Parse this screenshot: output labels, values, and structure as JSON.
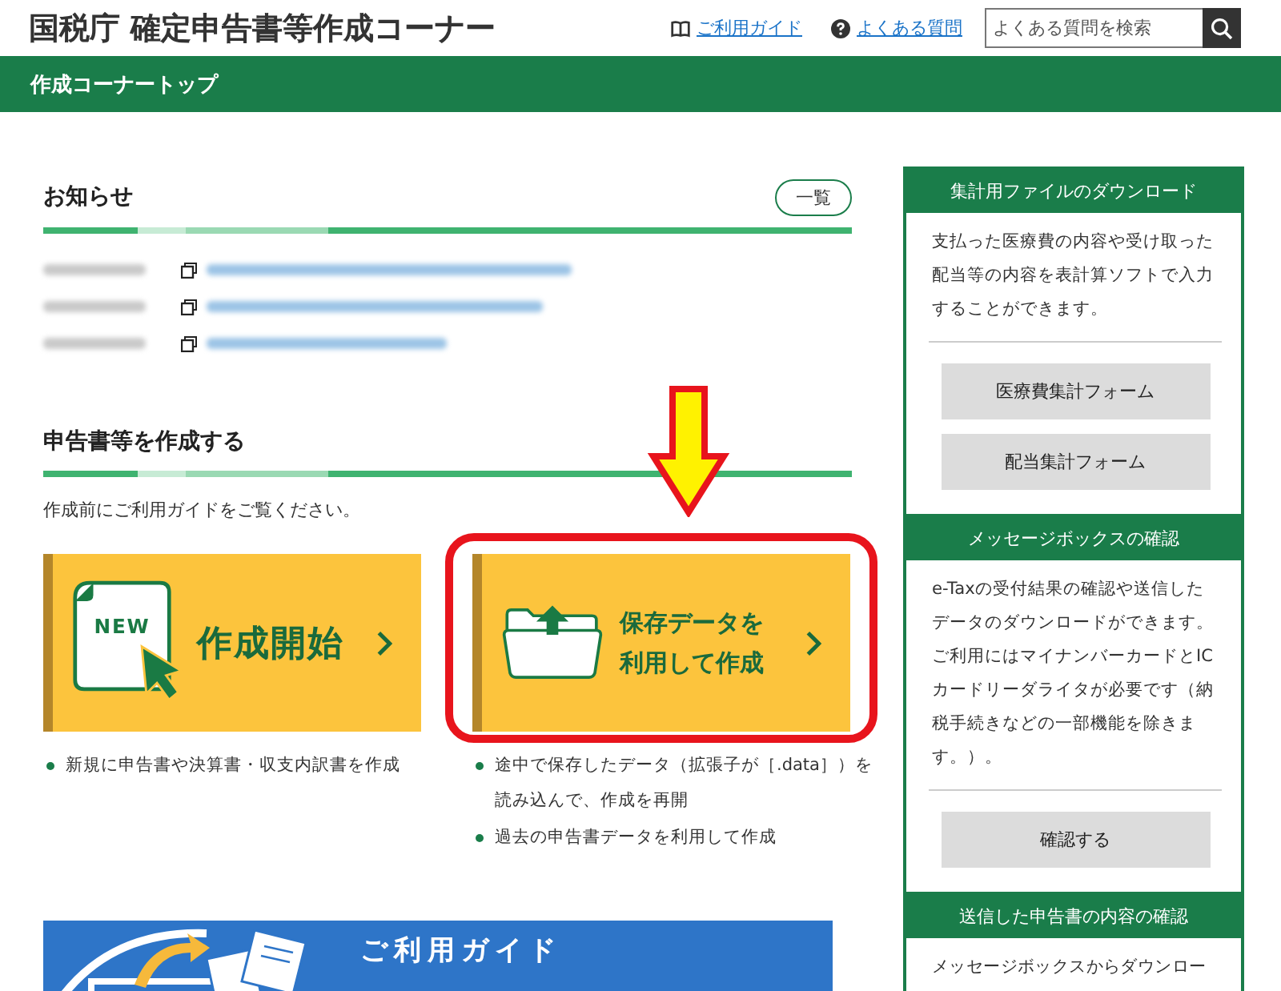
{
  "header": {
    "title": "国税庁 確定申告書等作成コーナー",
    "links": [
      {
        "kind": "guide",
        "label": "ご利用ガイド"
      },
      {
        "kind": "faq",
        "label": "よくある質問"
      }
    ],
    "search": {
      "placeholder": "よくある質問を検索"
    }
  },
  "nav": {
    "title": "作成コーナートップ"
  },
  "news": {
    "heading": "お知らせ",
    "list_button": "一覧"
  },
  "create": {
    "heading": "申告書等を作成する",
    "note": "作成前にご利用ガイドをご覧ください。",
    "options": [
      {
        "kind": "new",
        "badge": "NEW",
        "label_lines": [
          "作成開始"
        ],
        "highlighted": false,
        "bullets": [
          "新規に申告書や決算書・収支内訳書を作成"
        ]
      },
      {
        "kind": "saved",
        "label_lines": [
          "保存データを",
          "利用して作成"
        ],
        "highlighted": true,
        "bullets": [
          "途中で保存したデータ（拡張子が［.data］）を読み込んで、作成を再開",
          "過去の申告書データを利用して作成"
        ]
      }
    ]
  },
  "guide_banner": {
    "title": "ご利用ガイド"
  },
  "sidebar": {
    "panels": [
      {
        "title": "集計用ファイルのダウンロード",
        "text": "支払った医療費の内容や受け取った配当等の内容を表計算ソフトで入力することができます。",
        "buttons": [
          "医療費集計フォーム",
          "配当集計フォーム"
        ]
      },
      {
        "title": "メッセージボックスの確認",
        "text": "e-Taxの受付結果の確認や送信したデータのダウンロードができます。ご利用にはマイナンバーカードとICカードリーダライタが必要です（納税手続きなどの一部機能を除きます。）。",
        "buttons": [
          "確認する"
        ]
      },
      {
        "title": "送信した申告書の内容の確認",
        "text": "メッセージボックスからダウンロー"
      }
    ]
  }
}
